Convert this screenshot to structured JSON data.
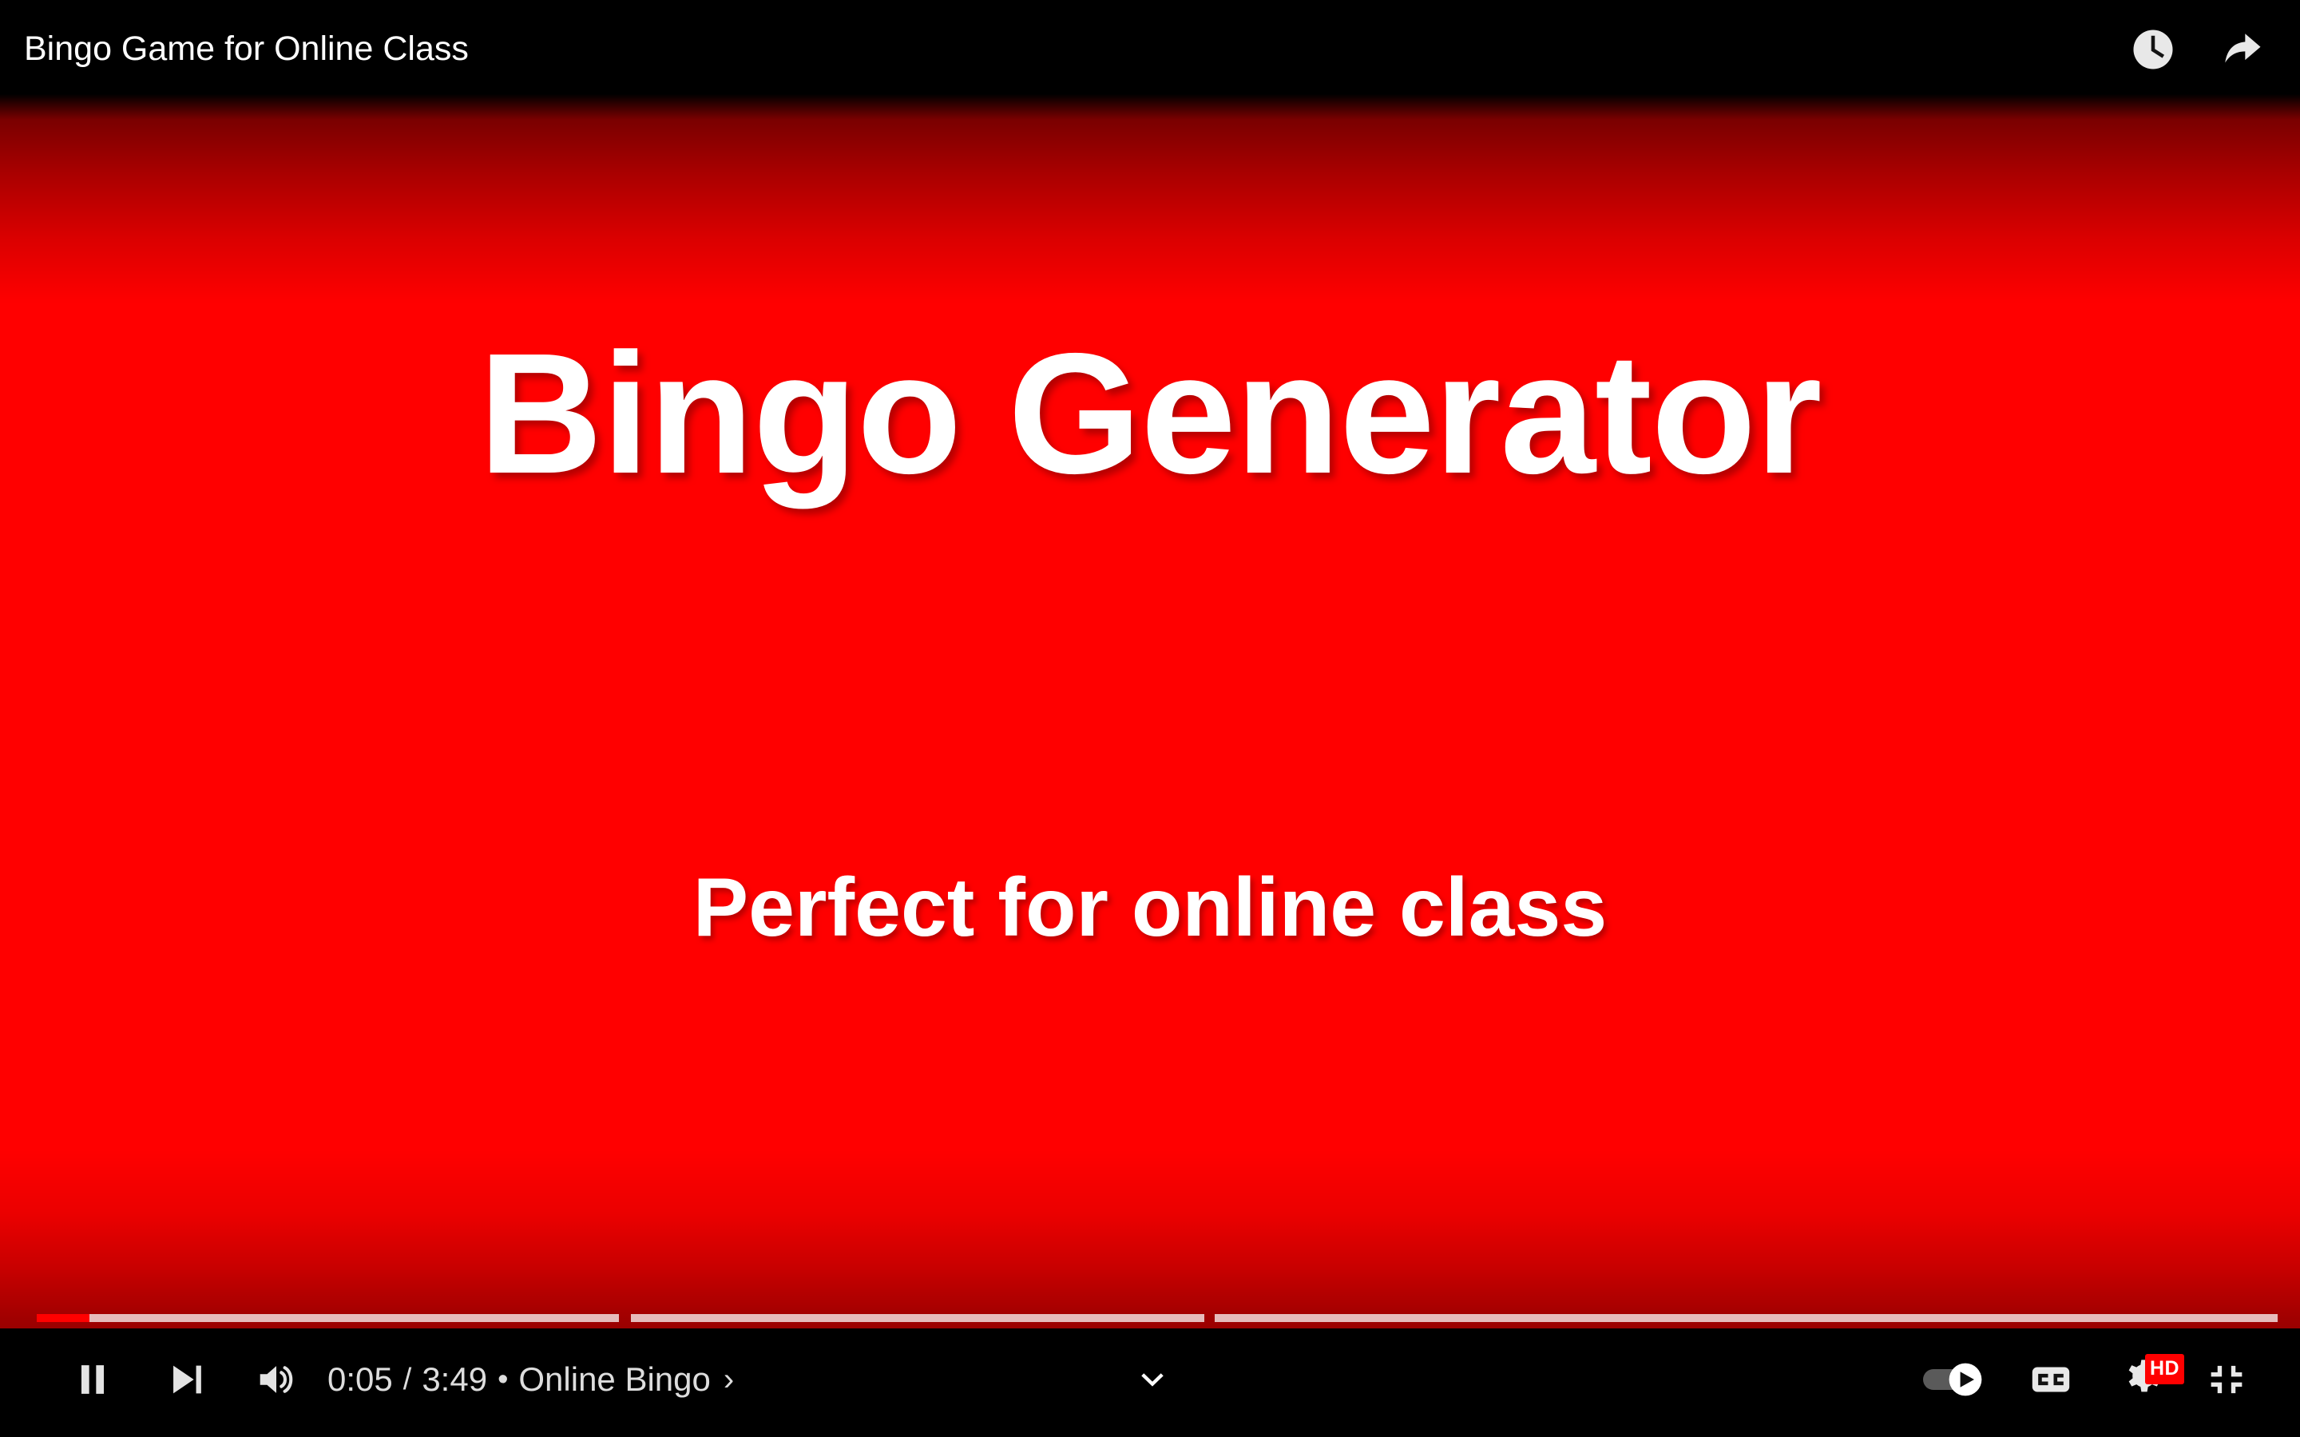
{
  "player": {
    "title": "Bingo Game for Online Class",
    "accent_color": "#ff0000",
    "background_color": "#000000"
  },
  "top_bar": {
    "title": "Bingo Game for Online Class",
    "watch_later_icon": "clock-icon",
    "share_icon": "share-icon"
  },
  "video": {
    "background_color": "#ff0000",
    "heading": "Bingo Generator",
    "subheading": "Perfect for online class",
    "text_color": "#ffffff"
  },
  "controls": {
    "pause_icon": "pause-icon",
    "next_icon": "next-video-icon",
    "volume_icon": "volume-on-icon",
    "current_time": "0:05",
    "time_separator": "/",
    "duration": "3:49",
    "chapter_dot": "•",
    "chapter_title": "Online Bingo",
    "chapter_chevron": "›",
    "expand_chapters_icon": "chevron-down-icon",
    "autoplay_icon": "autoplay-toggle-icon",
    "autoplay_state": "on",
    "subtitles_icon": "closed-captions-icon",
    "subtitles_label": "CC",
    "settings_icon": "gear-icon",
    "quality_badge": "HD",
    "fullscreen_icon": "exit-fullscreen-icon"
  },
  "progress": {
    "played_color": "#ff0000",
    "buffer_color": "rgba(255,255,255,0.30)",
    "track_color": "rgba(255,255,255,0.62)",
    "played_percent": 2.2,
    "chapters": [
      {
        "start_percent": 1.6,
        "end_percent": 26.9
      },
      {
        "start_percent": 27.4,
        "end_percent": 52.3
      },
      {
        "start_percent": 52.8,
        "end_percent": 99.0
      }
    ]
  }
}
